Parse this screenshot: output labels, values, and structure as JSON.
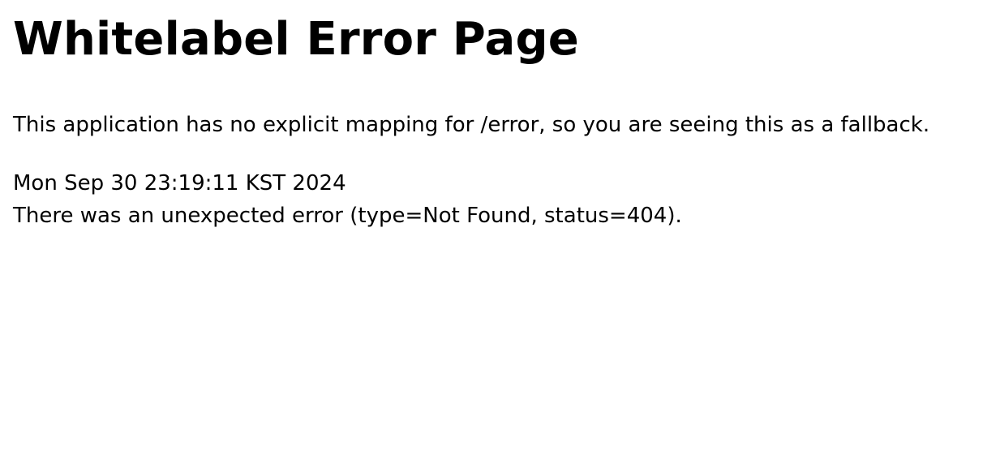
{
  "page": {
    "title": "Whitelabel Error Page",
    "description": "This application has no explicit mapping for /error, so you are seeing this as a fallback.",
    "timestamp": "Mon Sep 30 23:19:11 KST 2024",
    "error_message": "There was an unexpected error (type=Not Found, status=404)."
  },
  "colors": {
    "background": "#ffffff",
    "text": "#000000"
  }
}
